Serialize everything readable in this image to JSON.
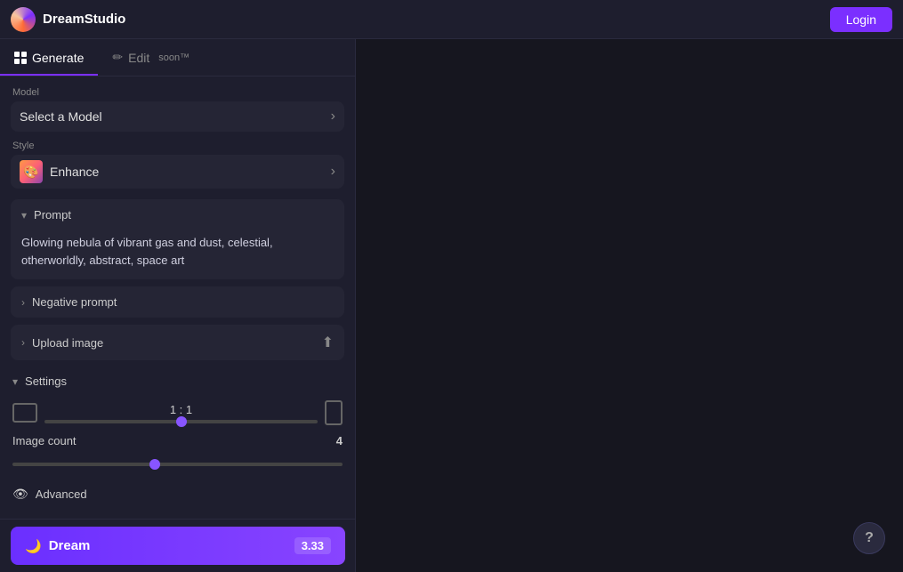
{
  "topbar": {
    "logo_text": "DreamStudio",
    "login_label": "Login"
  },
  "tabs": {
    "generate": {
      "label": "Generate",
      "active": true
    },
    "edit": {
      "label": "Edit",
      "active": false,
      "badge": "soon™"
    }
  },
  "model": {
    "section_label": "Model",
    "placeholder": "Select a Model"
  },
  "style": {
    "section_label": "Style",
    "selected": "Enhance",
    "emoji": "🎨"
  },
  "prompt": {
    "header_label": "Prompt",
    "text": "Glowing nebula of vibrant gas and dust, celestial, otherworldly, abstract, space art"
  },
  "negative_prompt": {
    "label": "Negative prompt"
  },
  "upload_image": {
    "label": "Upload image"
  },
  "settings": {
    "label": "Settings",
    "aspect_ratio": {
      "value": "1 : 1",
      "slider_min": 0,
      "slider_max": 100,
      "slider_value": 50
    }
  },
  "image_count": {
    "label": "Image count",
    "value": 4,
    "slider_min": 1,
    "slider_max": 8,
    "slider_value": 4
  },
  "advanced": {
    "label": "Advanced"
  },
  "dream_button": {
    "label": "Dream",
    "cost": "3.33"
  },
  "help": {
    "label": "?"
  }
}
